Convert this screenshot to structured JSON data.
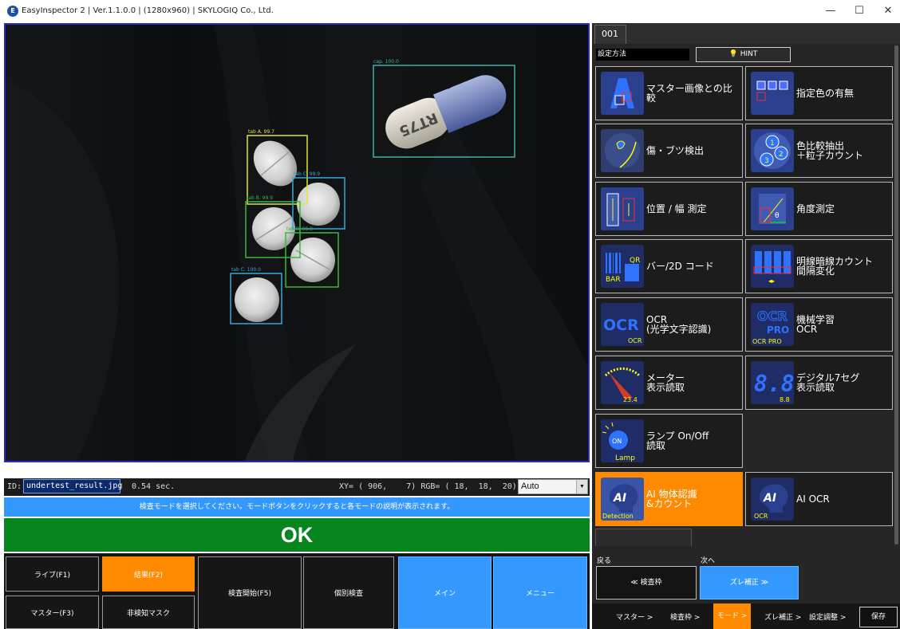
{
  "window": {
    "title": "EasyInspector 2 | Ver.1.1.0.0 | (1280x960) | SKYLOGIQ Co., Ltd.",
    "minimize": "—",
    "maximize": "☐",
    "close": "✕"
  },
  "camera": {
    "detections": [
      {
        "label": "cap. 100.0",
        "color": "#3fb0a8"
      },
      {
        "label": "tab A. 99.7",
        "color": "#e3e33a"
      },
      {
        "label": "tab C. 99.9",
        "color": "#39a7d6"
      },
      {
        "label": "tab B. 99.9",
        "color": "#3cb83c"
      },
      {
        "label": "tab B. 99.9",
        "color": "#3cb83c"
      },
      {
        "label": "tab C. 100.0",
        "color": "#39a7d6"
      }
    ],
    "capsule_print": "RT75"
  },
  "info": {
    "id_label": "ID:",
    "id_value": "undertest_result.jpg",
    "time": "0.54 sec.",
    "xy_rgb": "XY= ( 906,    7) RGB= ( 18,  18,  20)",
    "select_value": "Auto"
  },
  "message": "検査モードを選択してください。モードボタンをクリックすると各モードの説明が表示されます。",
  "result": "OK",
  "bottom_buttons": {
    "live": "ライブ(F1)",
    "result": "結果(F2)",
    "master": "マスター(F3)",
    "nondetect_mask": "非検知マスク",
    "start_inspection": "検査開始(F5)",
    "individual": "個別検査",
    "main": "メイン",
    "menu": "メニュー"
  },
  "right_panel": {
    "tab": "001",
    "setting_method": "設定方法",
    "hint": "HINT",
    "modes": [
      {
        "label": "マスター画像との比\n較",
        "icon": "master-compare-icon"
      },
      {
        "label": "指定色の有無",
        "icon": "color-presence-icon"
      },
      {
        "label": "傷・ブツ検出",
        "icon": "scratch-detect-icon"
      },
      {
        "label": "色比較抽出\n＋粒子カウント",
        "icon": "particle-count-icon"
      },
      {
        "label": "位置 / 幅 測定",
        "icon": "position-width-icon"
      },
      {
        "label": "角度測定",
        "icon": "angle-icon"
      },
      {
        "label": "バー/2D コード",
        "icon": "barcode-icon",
        "icon_text": [
          "QR",
          "BAR"
        ]
      },
      {
        "label": "明線暗線カウント\n間隔変化",
        "icon": "line-count-icon"
      },
      {
        "label": "OCR\n(光学文字認識)",
        "icon": "ocr-icon",
        "icon_text": [
          "OCR",
          "OCR"
        ]
      },
      {
        "label": "機械学習\nOCR",
        "icon": "ml-ocr-icon",
        "icon_text": [
          "OCR",
          "PRO",
          "OCR PRO"
        ]
      },
      {
        "label": "メーター\n表示読取",
        "icon": "meter-icon",
        "icon_text": [
          "23.4"
        ]
      },
      {
        "label": "デジタル7セグ\n表示読取",
        "icon": "seven-seg-icon",
        "icon_text": [
          "8.8",
          "8.8"
        ]
      },
      {
        "label": "ランプ On/Off\n読取",
        "icon": "lamp-icon",
        "icon_text": [
          "ON",
          "Lamp"
        ]
      },
      {
        "label": "AI 物体認識\n&カウント",
        "icon": "ai-detection-icon",
        "icon_text": [
          "AI",
          "Detection"
        ]
      },
      {
        "label": "AI OCR",
        "icon": "ai-ocr-icon",
        "icon_text": [
          "AI",
          "OCR"
        ]
      }
    ],
    "back_label": "戻る",
    "next_label": "次へ",
    "back_button": "≪ 検査枠",
    "next_button": "ズレ補正 ≫",
    "crumbs": [
      "マスター >",
      "検査枠 >",
      "モード >",
      "ズレ補正 >",
      "設定調整 >"
    ],
    "save": "保存"
  },
  "colors": {
    "accent_orange": "#ff8a00",
    "accent_blue": "#3399ff",
    "ok_green": "#07851e"
  }
}
